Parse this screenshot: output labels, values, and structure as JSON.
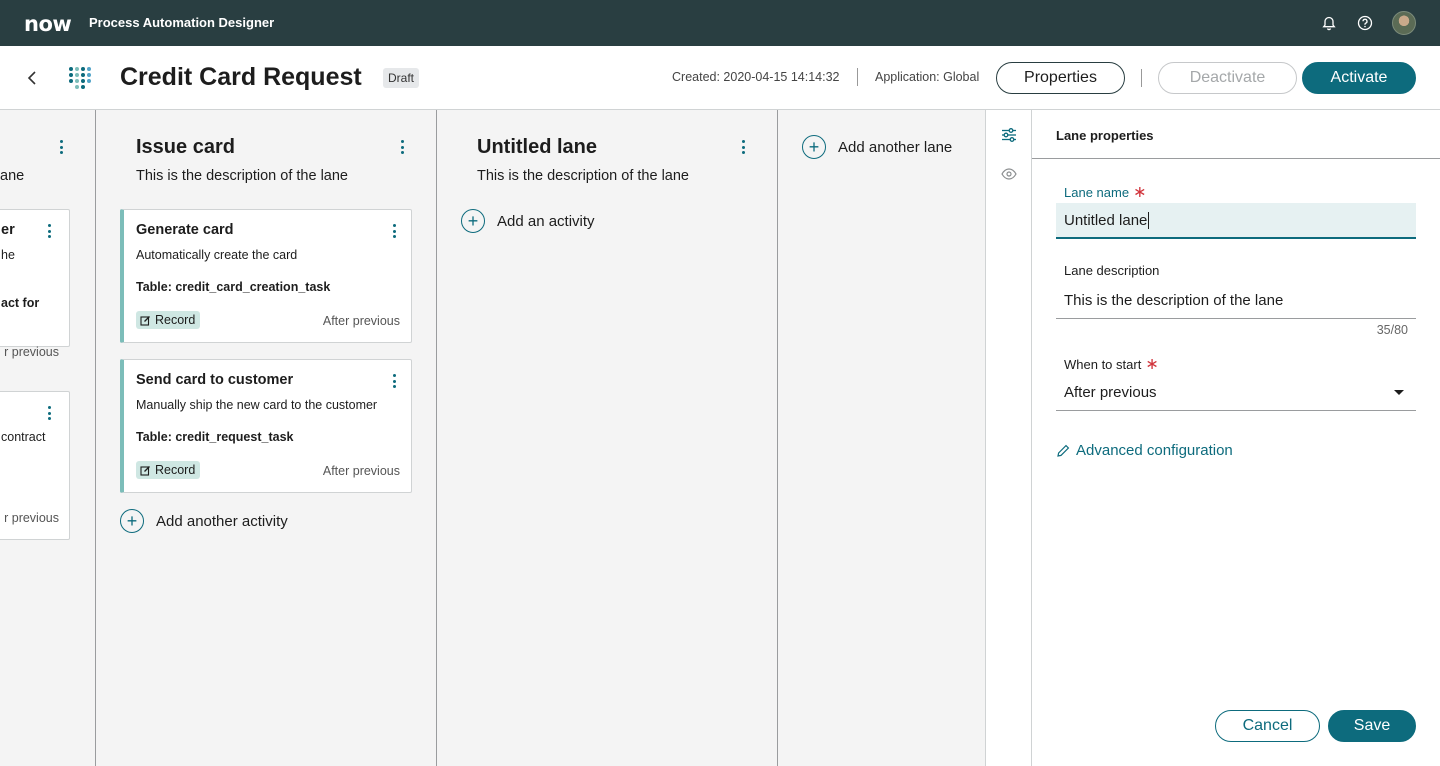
{
  "topbar": {
    "logo": "now",
    "app_title": "Process Automation Designer",
    "icons": [
      "bell-icon",
      "help-icon",
      "avatar"
    ]
  },
  "header": {
    "title": "Credit Card Request",
    "status_badge": "Draft",
    "created": "Created: 2020-04-15 14:14:32",
    "application": "Application: Global",
    "properties_label": "Properties",
    "deactivate_label": "Deactivate",
    "activate_label": "Activate"
  },
  "lanes": {
    "left_partial": {
      "desc_fragment": "ane",
      "card1": {
        "title_fragment": "er",
        "desc_fragment": "he",
        "table_fragment": "act for",
        "timing_fragment": "r previous"
      },
      "card2": {
        "desc_fragment": "contract",
        "timing_fragment": "r previous"
      }
    },
    "issue": {
      "title": "Issue card",
      "description": "This is the description of the lane",
      "cards": [
        {
          "title": "Generate card",
          "description": "Automatically create the card",
          "table": "Table: credit_card_creation_task",
          "tag": "Record",
          "timing": "After previous"
        },
        {
          "title": "Send card to customer",
          "description": "Manually ship the new card to the customer",
          "table": "Table: credit_request_task",
          "tag": "Record",
          "timing": "After previous"
        }
      ],
      "add_label": "Add another activity"
    },
    "untitled": {
      "title": "Untitled lane",
      "description": "This is the description of the lane",
      "add_label": "Add an activity"
    },
    "add_lane_label": "Add another lane"
  },
  "panel": {
    "title": "Lane properties",
    "lane_name_label": "Lane name",
    "lane_name_value": "Untitled lane",
    "lane_desc_label": "Lane description",
    "lane_desc_value": "This is the description of the lane",
    "char_counter": "35/80",
    "when_label": "When to start",
    "when_value": "After previous",
    "advanced_label": "Advanced configuration",
    "cancel_label": "Cancel",
    "save_label": "Save"
  },
  "colors": {
    "topbar": "#293e41",
    "accent": "#0d6b7d",
    "card_border": "#7cbdb9",
    "required": "#d1333b"
  }
}
